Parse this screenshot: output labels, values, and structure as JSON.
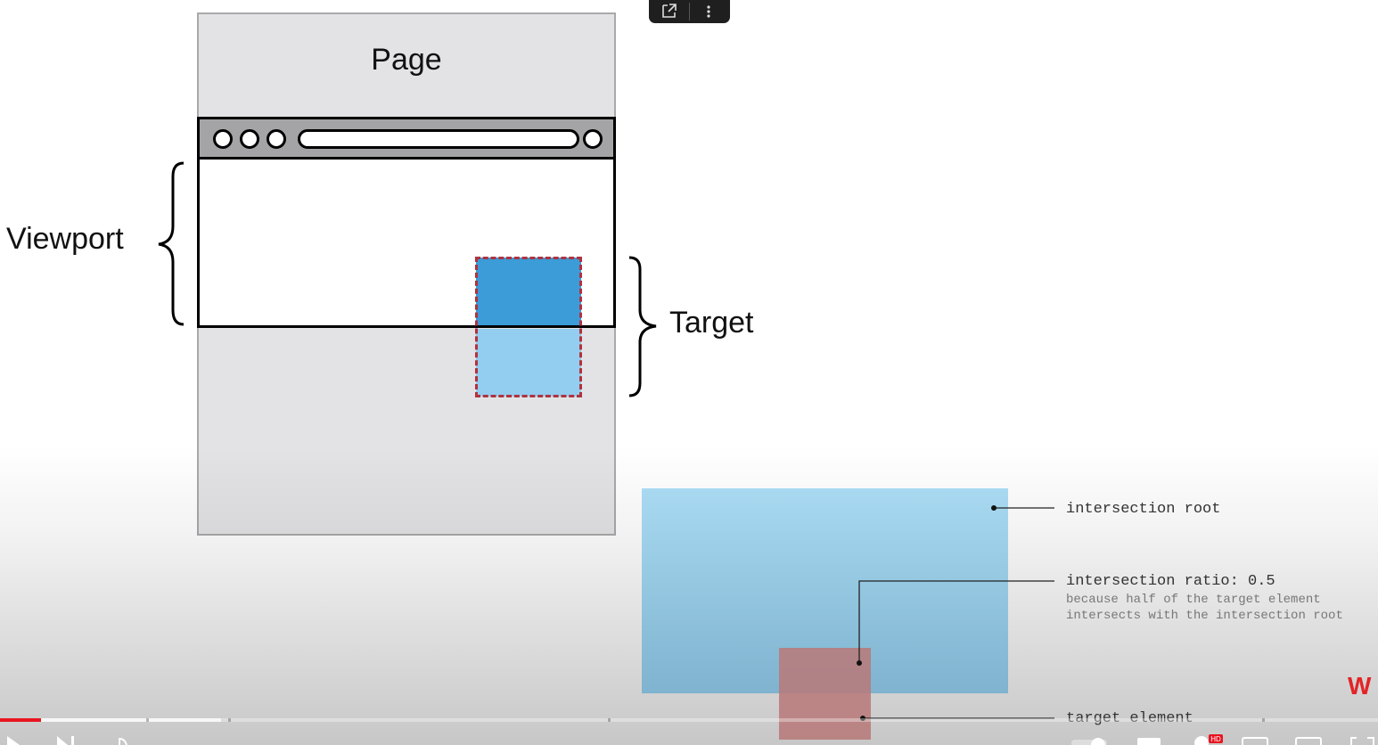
{
  "diagram": {
    "page_label": "Page",
    "viewport_label": "Viewport",
    "target_label": "Target"
  },
  "callouts": {
    "root_label": "intersection root",
    "ratio_label": "intersection ratio: 0.5",
    "ratio_note_line1": "because half of the target element",
    "ratio_note_line2": "intersects with the intersection root",
    "element_label": "target element"
  },
  "player": {
    "share_icon": "share-icon",
    "more_icon": "more-vert-icon",
    "play_icon": "play-icon",
    "next_icon": "next-icon",
    "volume_icon": "volume-icon",
    "settings_icon": "settings-icon",
    "fullscreen_icon": "fullscreen-icon",
    "hd_badge": "HD",
    "progress_fraction": 0.03,
    "accent_color": "#e8141f"
  },
  "colors": {
    "target_in_view": "#3b9cd8",
    "target_out_of_view": "#93cdef",
    "target_outline": "#b0323f",
    "root_box": "#a8d9f1",
    "element_box": "#b97878"
  }
}
